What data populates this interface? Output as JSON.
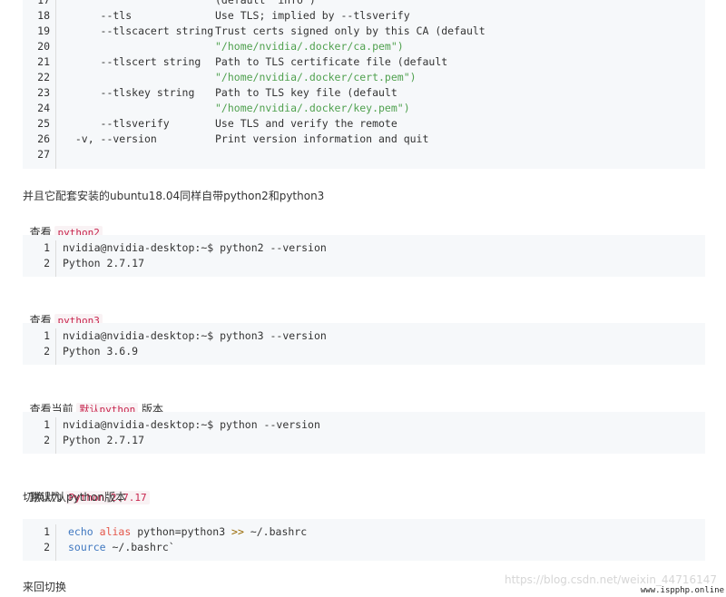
{
  "block1": {
    "lines": [
      {
        "num": "17",
        "left": "",
        "right": "(default \"info\")",
        "right_is_str": false
      },
      {
        "num": "18",
        "left": "      --tls",
        "right": "Use TLS; implied by --tlsverify"
      },
      {
        "num": "19",
        "left": "      --tlscacert string",
        "right": "Trust certs signed only by this CA (default"
      },
      {
        "num": "20",
        "left": "",
        "right": "\"/home/nvidia/.docker/ca.pem\")"
      },
      {
        "num": "21",
        "left": "      --tlscert string",
        "right": "Path to TLS certificate file (default"
      },
      {
        "num": "22",
        "left": "",
        "right": "\"/home/nvidia/.docker/cert.pem\")"
      },
      {
        "num": "23",
        "left": "      --tlskey string",
        "right": "Path to TLS key file (default"
      },
      {
        "num": "24",
        "left": "",
        "right": "\"/home/nvidia/.docker/key.pem\")"
      },
      {
        "num": "25",
        "left": "      --tlsverify",
        "right": "Use TLS and verify the remote"
      },
      {
        "num": "26",
        "left": "  -v, --version",
        "right": "Print version information and quit"
      },
      {
        "num": "27",
        "left": "",
        "right": ""
      }
    ]
  },
  "text": {
    "p1": "并且它配套安装的ubuntu18.04同样自带python2和python3",
    "p2_prefix": "查看 ",
    "p2_code": "python2",
    "p3_prefix": "查看 ",
    "p3_code": "python3",
    "p4_prefix": "查看当前 ",
    "p4_code": "默认python",
    "p4_suffix": " 版本",
    "p5_prefix": "默认为 ",
    "p5_code": "Python 2.7.17",
    "p6": "切换默认python版本",
    "p7": "来回切换"
  },
  "block2": {
    "l1": "nvidia@nvidia-desktop:~$ python2 --version",
    "l2": "Python 2.7.17"
  },
  "block3": {
    "l1": "nvidia@nvidia-desktop:~$ python3 --version",
    "l2": "Python 3.6.9"
  },
  "block4": {
    "l1": "nvidia@nvidia-desktop:~$ python --version",
    "l2": "Python 2.7.17"
  },
  "block5": {
    "echo": "echo",
    "alias": "alias",
    "l1_rest": " python=python3 ",
    "redir": ">>",
    "l1_tail": " ~/.bashrc",
    "source": "source",
    "l2_rest": " ~/.bashrc`"
  },
  "watermark": "https://blog.csdn.net/weixin_44716147",
  "site_stamp": "www.ispphp.online"
}
